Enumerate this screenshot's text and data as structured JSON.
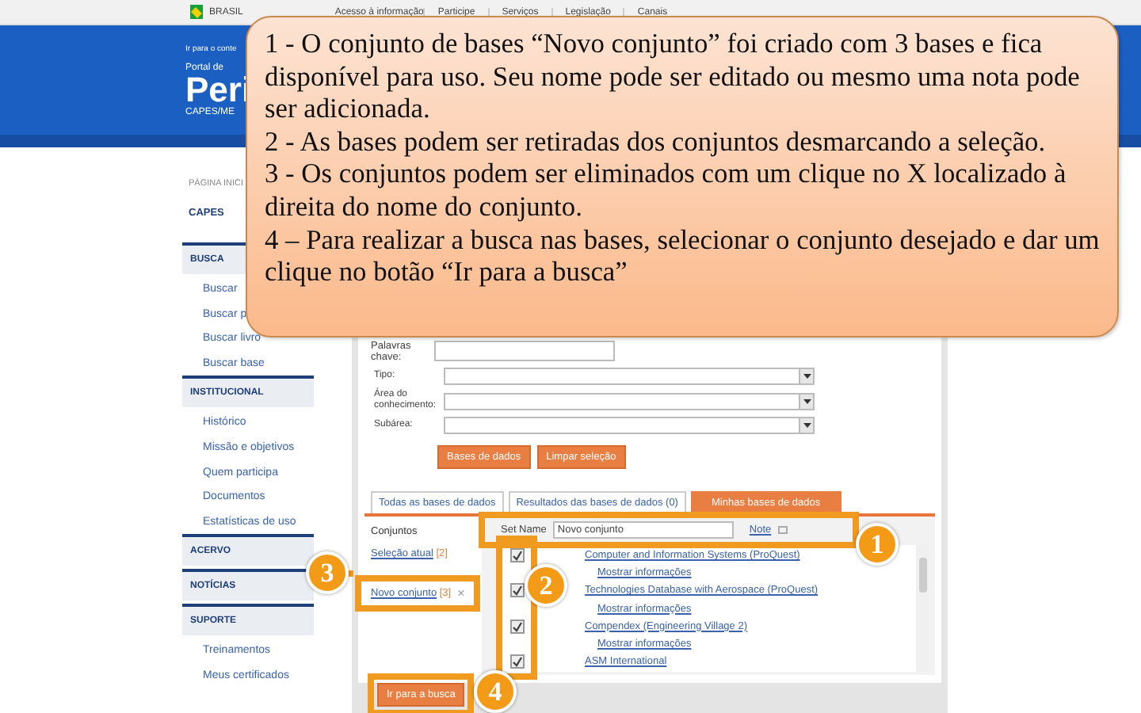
{
  "gov_bar": {
    "country": "BRASIL",
    "access_link": "Acesso à informação",
    "links": [
      "Participe",
      "Serviços",
      "Legislação",
      "Canais"
    ]
  },
  "header": {
    "skip_link": "Ir para o conte",
    "portal_label": "Portal de",
    "title": "Peri",
    "subtitle": "CAPES/ME"
  },
  "sidebar": {
    "breadcrumb": "PÁGINA INICI",
    "top_link": "CAPES",
    "sections": [
      {
        "title": "BUSCA",
        "items": [
          "Buscar",
          "Buscar p",
          "Buscar livro",
          "Buscar base"
        ]
      },
      {
        "title": "INSTITUCIONAL",
        "items": [
          "Histórico",
          "Missão e objetivos",
          "Quem participa",
          "Documentos",
          "Estatísticas de uso"
        ]
      },
      {
        "title": "ACERVO"
      },
      {
        "title": "NOTÍCIAS"
      },
      {
        "title": "SUPORTE",
        "items": [
          "Treinamentos",
          "Meus certificados"
        ]
      }
    ]
  },
  "search_form": {
    "keywords_label": "Palavras chave:",
    "fields": [
      {
        "label": "Tipo:"
      },
      {
        "label": "Área do conhecimento:"
      },
      {
        "label": "Subárea:"
      }
    ],
    "buttons": [
      "Bases de dados",
      "Limpar seleção"
    ]
  },
  "tabs": [
    {
      "label": "Todas as bases de dados",
      "selected": false
    },
    {
      "label": "Resultados das bases de dados (0)",
      "selected": false
    },
    {
      "label": "Minhas bases de dados",
      "selected": true
    }
  ],
  "sets": {
    "title": "Conjuntos",
    "items": [
      {
        "name": "Seleção atual",
        "count": "[2]"
      },
      {
        "name": "Novo conjunto",
        "count": "[3]",
        "remove": "×"
      }
    ]
  },
  "set_editor": {
    "name_label": "Set Name",
    "name_value": "Novo conjunto",
    "note_link": "Note"
  },
  "databases": [
    {
      "kind": "database",
      "text": "Computer and Information Systems (ProQuest)",
      "checked": true
    },
    {
      "kind": "info",
      "text": "Mostrar informações"
    },
    {
      "kind": "database",
      "text": "Technologies Database with Aerospace (ProQuest)",
      "checked": true
    },
    {
      "kind": "info",
      "text": "Mostrar informações"
    },
    {
      "kind": "database",
      "text": "Compendex (Engineering Village 2)",
      "checked": true
    },
    {
      "kind": "info",
      "text": "Mostrar informações"
    },
    {
      "kind": "database",
      "text": "ASM International",
      "checked": true
    }
  ],
  "go_button": "Ir para a busca",
  "callout": {
    "paragraphs": [
      "1 - O conjunto de bases “Novo conjunto” foi criado com 3 bases e fica disponível para uso. Seu nome pode ser editado ou mesmo uma nota pode ser adicionada.",
      "2 - As bases podem ser retiradas dos conjuntos desmarcando a seleção.",
      "3 - Os conjuntos podem ser eliminados com um clique no X localizado à direita do nome do conjunto.",
      "4 – Para realizar a busca nas bases, selecionar o conjunto desejado e dar um clique no botão “Ir para a busca”"
    ]
  },
  "markers": [
    "1",
    "2",
    "3",
    "4"
  ]
}
